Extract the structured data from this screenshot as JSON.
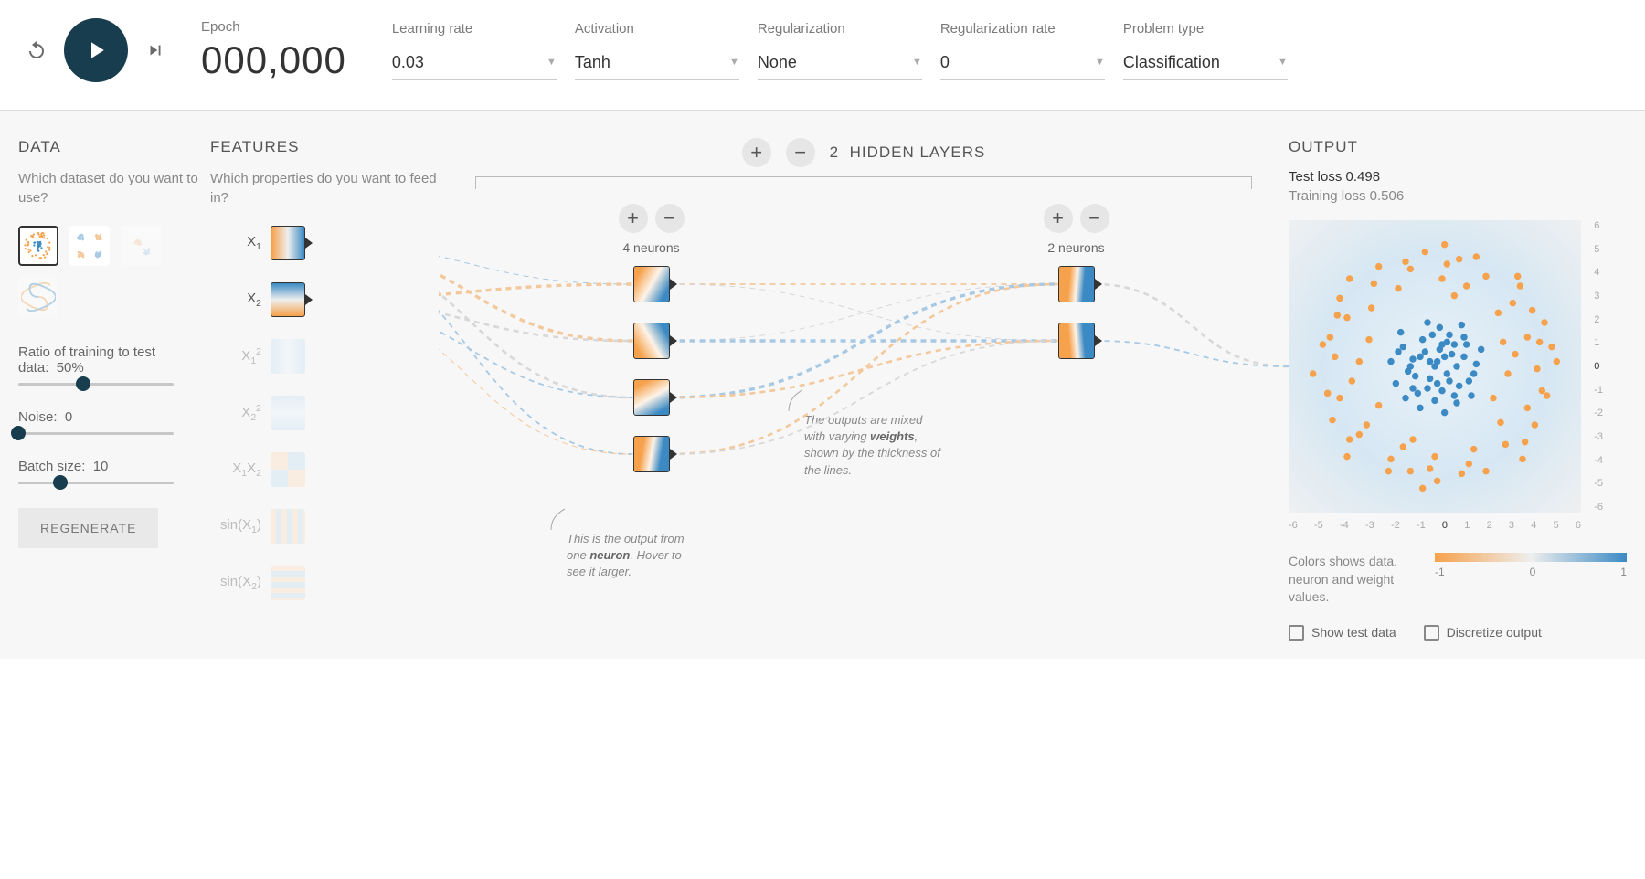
{
  "controls": {
    "epoch_label": "Epoch",
    "epoch_value": "000,000",
    "learning_rate": {
      "label": "Learning rate",
      "value": "0.03"
    },
    "activation": {
      "label": "Activation",
      "value": "Tanh"
    },
    "regularization": {
      "label": "Regularization",
      "value": "None"
    },
    "reg_rate": {
      "label": "Regularization rate",
      "value": "0"
    },
    "problem": {
      "label": "Problem type",
      "value": "Classification"
    }
  },
  "data_panel": {
    "title": "DATA",
    "subtitle": "Which dataset do you want to use?",
    "ratio": {
      "label": "Ratio of training to test data:",
      "value": "50%",
      "pct": 42
    },
    "noise": {
      "label": "Noise:",
      "value": "0",
      "pct": 0
    },
    "batch": {
      "label": "Batch size:",
      "value": "10",
      "pct": 27
    },
    "regenerate": "REGENERATE"
  },
  "features_panel": {
    "title": "FEATURES",
    "subtitle": "Which properties do you want to feed in?",
    "items": [
      {
        "label_html": "X<sub>1</sub>",
        "active": true,
        "grad": "linear-gradient(90deg,#f6a14b,#eee,#3b8ac4)"
      },
      {
        "label_html": "X<sub>2</sub>",
        "active": true,
        "grad": "linear-gradient(180deg,#3b8ac4,#eee,#f6a14b)"
      },
      {
        "label_html": "X<sub>1</sub><sup>2</sup>",
        "active": false,
        "grad": "linear-gradient(90deg,#cfe4f2,#eef5fa,#cfe4f2)"
      },
      {
        "label_html": "X<sub>2</sub><sup>2</sup>",
        "active": false,
        "grad": "linear-gradient(180deg,#cfe4f2,#eef5fa,#cfe4f2)"
      },
      {
        "label_html": "X<sub>1</sub>X<sub>2</sub>",
        "active": false,
        "grad": "conic-gradient(#cfe4f2 0 25%,#fbe2cb 0 50%,#cfe4f2 0 75%,#fbe2cb 0)"
      },
      {
        "label_html": "sin(X<sub>1</sub>)",
        "active": false,
        "grad": "repeating-linear-gradient(90deg,#fbe2cb 0 6px,#cfe4f2 6px 12px)"
      },
      {
        "label_html": "sin(X<sub>2</sub>)",
        "active": false,
        "grad": "repeating-linear-gradient(180deg,#fbe2cb 0 6px,#cfe4f2 6px 12px)"
      }
    ]
  },
  "network": {
    "hidden_layers_label": "HIDDEN LAYERS",
    "hidden_layers_count": "2",
    "layers": [
      {
        "caption": "4 neurons",
        "n": 4
      },
      {
        "caption": "2 neurons",
        "n": 2
      }
    ],
    "callout_neuron": "This is the output from one <b>neuron</b>. Hover to see it larger.",
    "callout_weights": "The outputs are mixed with varying <b>weights</b>, shown by the thickness of the lines."
  },
  "output_panel": {
    "title": "OUTPUT",
    "test_loss_label": "Test loss",
    "test_loss_value": "0.498",
    "train_loss_label": "Training loss",
    "train_loss_value": "0.506",
    "axis_min": -6,
    "axis_max": 6,
    "legend_text": "Colors shows data, neuron and weight values.",
    "legend_min": "-1",
    "legend_mid": "0",
    "legend_max": "1",
    "check_test": "Show test data",
    "check_disc": "Discretize output"
  },
  "chart_data": {
    "type": "scatter",
    "title": "OUTPUT",
    "xlim": [
      -6,
      6
    ],
    "ylim": [
      -6,
      6
    ],
    "xlabel": "",
    "ylabel": "",
    "xticks": [
      -6,
      -5,
      -4,
      -3,
      -2,
      -1,
      0,
      1,
      2,
      3,
      4,
      5,
      6
    ],
    "yticks": [
      -6,
      -5,
      -4,
      -3,
      -2,
      -1,
      0,
      1,
      2,
      3,
      4,
      5,
      6
    ],
    "series": [
      {
        "name": "class-blue",
        "color": "#3b8ac4",
        "points": [
          [
            0.1,
            0.2
          ],
          [
            0.5,
            -0.3
          ],
          [
            -0.4,
            0.6
          ],
          [
            -0.2,
            -0.5
          ],
          [
            0.8,
            0.9
          ],
          [
            -0.9,
            0.3
          ],
          [
            0.3,
            -1.0
          ],
          [
            1.2,
            0.4
          ],
          [
            -1.1,
            -0.2
          ],
          [
            0.6,
            1.3
          ],
          [
            -0.7,
            -1.1
          ],
          [
            1.4,
            -0.6
          ],
          [
            -1.3,
            0.8
          ],
          [
            0.2,
            1.6
          ],
          [
            1.7,
            0.1
          ],
          [
            -1.6,
            -0.7
          ],
          [
            0.9,
            -1.5
          ],
          [
            -0.3,
            1.8
          ],
          [
            1.9,
            0.7
          ],
          [
            -1.8,
            0.2
          ],
          [
            0.4,
            -1.9
          ],
          [
            1.1,
            1.7
          ],
          [
            -1.4,
            1.4
          ],
          [
            1.5,
            -1.2
          ],
          [
            -0.6,
            -1.7
          ],
          [
            0.0,
            0.0
          ],
          [
            0.7,
            0.5
          ],
          [
            -0.5,
            1.1
          ],
          [
            1.0,
            -0.8
          ],
          [
            -1.0,
            0.0
          ],
          [
            0.3,
            0.9
          ],
          [
            -0.8,
            -0.4
          ],
          [
            1.3,
            0.9
          ],
          [
            -1.2,
            -1.3
          ],
          [
            0.5,
            1.0
          ],
          [
            1.6,
            -0.3
          ],
          [
            -1.5,
            0.6
          ],
          [
            0.8,
            -1.2
          ],
          [
            -0.1,
            1.3
          ],
          [
            1.2,
            1.2
          ],
          [
            0.0,
            -1.4
          ],
          [
            0.4,
            0.4
          ],
          [
            -0.3,
            -0.9
          ],
          [
            0.9,
            0.0
          ],
          [
            -0.9,
            -0.9
          ],
          [
            0.2,
            0.7
          ],
          [
            0.6,
            -0.6
          ],
          [
            -0.6,
            0.4
          ],
          [
            -0.2,
            0.2
          ],
          [
            0.1,
            -0.7
          ]
        ]
      },
      {
        "name": "class-orange",
        "color": "#f6a14b",
        "points": [
          [
            3.8,
            1.2
          ],
          [
            3.2,
            2.6
          ],
          [
            2.1,
            3.7
          ],
          [
            0.5,
            4.2
          ],
          [
            -1.0,
            4.0
          ],
          [
            -2.5,
            3.4
          ],
          [
            -3.6,
            2.0
          ],
          [
            -4.1,
            0.4
          ],
          [
            -3.9,
            -1.3
          ],
          [
            -3.1,
            -2.8
          ],
          [
            -1.8,
            -3.8
          ],
          [
            -0.2,
            -4.2
          ],
          [
            1.4,
            -4.0
          ],
          [
            2.9,
            -3.2
          ],
          [
            3.8,
            -1.7
          ],
          [
            4.2,
            -0.1
          ],
          [
            4.5,
            1.8
          ],
          [
            3.5,
            3.3
          ],
          [
            1.7,
            4.5
          ],
          [
            -0.4,
            4.7
          ],
          [
            -2.3,
            4.1
          ],
          [
            -3.9,
            2.8
          ],
          [
            -4.6,
            0.9
          ],
          [
            -4.4,
            -1.1
          ],
          [
            -3.5,
            -3.0
          ],
          [
            -1.9,
            -4.3
          ],
          [
            0.1,
            -4.7
          ],
          [
            2.1,
            -4.3
          ],
          [
            3.7,
            -3.1
          ],
          [
            4.6,
            -1.2
          ],
          [
            4.8,
            0.8
          ],
          [
            2.8,
            1.0
          ],
          [
            2.4,
            -1.3
          ],
          [
            -2.7,
            1.1
          ],
          [
            -2.3,
            -1.6
          ],
          [
            0.8,
            2.9
          ],
          [
            -0.9,
            -3.0
          ],
          [
            3.0,
            -0.3
          ],
          [
            -3.1,
            0.2
          ],
          [
            1.3,
            3.3
          ],
          [
            -1.5,
            3.2
          ],
          [
            1.6,
            -3.4
          ],
          [
            -1.3,
            -3.3
          ],
          [
            3.3,
            0.5
          ],
          [
            -3.4,
            -0.6
          ],
          [
            4.0,
            2.3
          ],
          [
            -4.0,
            2.1
          ],
          [
            4.1,
            -2.4
          ],
          [
            -4.2,
            -2.2
          ],
          [
            0.3,
            3.6
          ],
          [
            0.0,
            -3.7
          ],
          [
            2.6,
            2.2
          ],
          [
            -2.6,
            2.4
          ],
          [
            2.7,
            -2.3
          ],
          [
            -2.8,
            -2.4
          ],
          [
            5.0,
            0.2
          ],
          [
            -5.0,
            -0.3
          ],
          [
            0.4,
            5.0
          ],
          [
            -0.5,
            -5.0
          ],
          [
            3.4,
            3.7
          ],
          [
            -3.5,
            3.6
          ],
          [
            3.6,
            -3.8
          ],
          [
            -3.6,
            -3.7
          ],
          [
            4.3,
            1.0
          ],
          [
            -4.3,
            1.2
          ],
          [
            4.4,
            -1.0
          ],
          [
            -4.4,
            -1.1
          ],
          [
            1.0,
            4.4
          ],
          [
            -1.2,
            4.3
          ],
          [
            1.1,
            -4.4
          ],
          [
            -1.0,
            -4.3
          ]
        ]
      }
    ]
  },
  "neuron_grads": [
    "linear-gradient(120deg,#f6a14b 15%,#fdf3e8 50%,#3b8ac4 85%)",
    "linear-gradient(60deg,#f6a14b 15%,#fdf3e8 50%,#3b8ac4 85%)",
    "linear-gradient(150deg,#f6a14b 15%,#fdf3e8 50%,#3b8ac4 85%)",
    "linear-gradient(100deg,#f6a14b 25%,#fdf3e8 50%,#3b8ac4 75%)",
    "linear-gradient(95deg,#f6a14b 30%,#fdf3e8 50%,#3b8ac4 70%)",
    "linear-gradient(85deg,#f6a14b 30%,#fdf3e8 50%,#3b8ac4 70%)"
  ]
}
